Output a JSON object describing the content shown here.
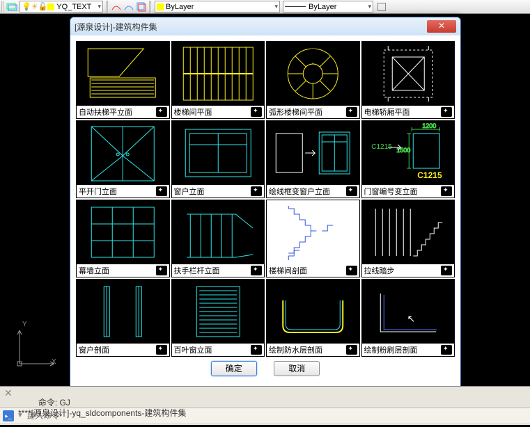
{
  "toolbar": {
    "layer_name": "YQ_TEXT",
    "color_label": "ByLayer",
    "linetype_label": "ByLayer"
  },
  "dialog": {
    "title": "[源泉设计]-建筑构件集",
    "items": [
      {
        "label": "自动扶梯平立面"
      },
      {
        "label": "楼梯间平面"
      },
      {
        "label": "弧形楼梯间平面"
      },
      {
        "label": "电梯轿厢平面"
      },
      {
        "label": "平开门立面"
      },
      {
        "label": "窗户立面"
      },
      {
        "label": "绘线框变窗户立面"
      },
      {
        "label": "门窗编号变立面"
      },
      {
        "label": "幕墙立面"
      },
      {
        "label": "扶手栏杆立面"
      },
      {
        "label": "楼梯间剖面"
      },
      {
        "label": "拉线踏步"
      },
      {
        "label": "窗户剖面"
      },
      {
        "label": "百叶窗立面"
      },
      {
        "label": "绘制防水层剖面"
      },
      {
        "label": "绘制粉刷层剖面"
      }
    ],
    "annotations": {
      "c1215": "C1215",
      "w1200": "1200",
      "h1500": "1500"
    },
    "ok": "确定",
    "cancel": "取消"
  },
  "ucs": {
    "x": "X",
    "y": "Y"
  },
  "command": {
    "hist1": "命令: GJ",
    "hist2": "****[源泉设计]-yq_sldcomponents-建筑构件集",
    "placeholder": "键入命令"
  }
}
